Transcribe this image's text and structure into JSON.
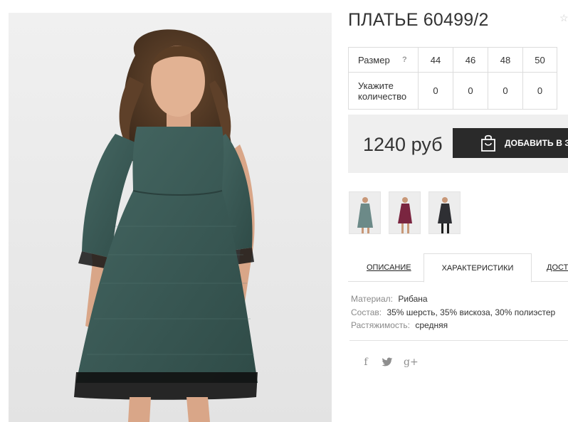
{
  "product": {
    "title": "ПЛАТЬЕ 60499/2",
    "main_image_icon": "dress-photo"
  },
  "sizes": {
    "header_label": "Размер",
    "help_label": "?",
    "values": [
      "44",
      "46",
      "48",
      "50"
    ],
    "quantity_label": "Укажите количество",
    "quantities": [
      "0",
      "0",
      "0",
      "0"
    ]
  },
  "price": {
    "value": "1240 руб"
  },
  "cart": {
    "button_label": "ДОБАВИТЬ В ЗАКАЗ",
    "icon": "shopping-bag-icon"
  },
  "thumbnails": [
    {
      "color": "#5d7f7e",
      "name": "green"
    },
    {
      "color": "#7a2540",
      "name": "burgundy"
    },
    {
      "color": "#2e2f33",
      "name": "black"
    }
  ],
  "tabs": [
    {
      "label": "ОПИСАНИЕ",
      "active": false
    },
    {
      "label": "ХАРАКТЕРИСТИКИ",
      "active": true
    },
    {
      "label": "ДОСТАВКА",
      "active": false
    }
  ],
  "specs": [
    {
      "key": "Материал:",
      "value": "Рибана"
    },
    {
      "key": "Состав:",
      "value": "35% шерсть, 35% вискоза, 30% полиэстер"
    },
    {
      "key": "Растяжимость:",
      "value": "средняя"
    }
  ],
  "social": {
    "facebook": "f",
    "twitter": "twitter-icon",
    "googleplus": "g+"
  },
  "colors": {
    "dress_green": "#3d5c58",
    "cart_button": "#2a2a2a",
    "price_bar": "#efefef"
  }
}
